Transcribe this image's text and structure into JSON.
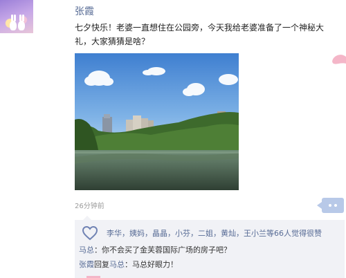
{
  "post": {
    "author": "张霞",
    "text": "七夕快乐！老婆一直想住在公园旁，今天我给老婆准备了一个神秘大礼，大家猜猜是啥？",
    "time": "26分钟前"
  },
  "likes": {
    "names": "李华，姨妈，晶晶，小芬，二姐，黄灿，王小兰",
    "count_text": "等66人觉得很赞"
  },
  "comments": [
    {
      "name": "马总",
      "separator": "：",
      "text": "你不会买了金芙蓉国际广场的房子吧？"
    },
    {
      "name": "张霞",
      "reply_word": "回复",
      "reply_to": "马总",
      "separator": "：",
      "text": "马总好眼力！"
    }
  ],
  "colors": {
    "name_link": "#576b95",
    "likes_bg": "#f1f2f6",
    "more_button": "#b8c9e8",
    "accent_pink": "#f4b6c8"
  },
  "icons": {
    "like": "heart-outline-icon",
    "more": "more-dots-icon",
    "decoration": "pink-heart-icon"
  }
}
